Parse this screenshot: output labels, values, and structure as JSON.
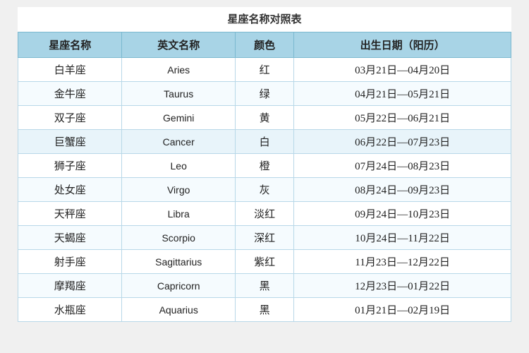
{
  "page": {
    "title": "星座名称对照表"
  },
  "table": {
    "headers": [
      "星座名称",
      "英文名称",
      "颜色",
      "出生日期（阳历）"
    ],
    "rows": [
      {
        "chinese": "白羊座",
        "english": "Aries",
        "color": "红",
        "dates": "03月21日—04月20日",
        "highlight": false
      },
      {
        "chinese": "金牛座",
        "english": "Taurus",
        "color": "绿",
        "dates": "04月21日—05月21日",
        "highlight": false
      },
      {
        "chinese": "双子座",
        "english": "Gemini",
        "color": "黄",
        "dates": "05月22日—06月21日",
        "highlight": false
      },
      {
        "chinese": "巨蟹座",
        "english": "Cancer",
        "color": "白",
        "dates": "06月22日—07月23日",
        "highlight": true
      },
      {
        "chinese": "狮子座",
        "english": "Leo",
        "color": "橙",
        "dates": "07月24日—08月23日",
        "highlight": false
      },
      {
        "chinese": "处女座",
        "english": "Virgo",
        "color": "灰",
        "dates": "08月24日—09月23日",
        "highlight": false
      },
      {
        "chinese": "天秤座",
        "english": "Libra",
        "color": "淡红",
        "dates": "09月24日—10月23日",
        "highlight": false
      },
      {
        "chinese": "天蝎座",
        "english": "Scorpio",
        "color": "深红",
        "dates": "10月24日—11月22日",
        "highlight": false
      },
      {
        "chinese": "射手座",
        "english": "Sagittarius",
        "color": "紫红",
        "dates": "11月23日—12月22日",
        "highlight": false
      },
      {
        "chinese": "摩羯座",
        "english": "Capricorn",
        "color": "黑",
        "dates": "12月23日—01月22日",
        "highlight": false
      },
      {
        "chinese": "水瓶座",
        "english": "Aquarius",
        "color": "黑",
        "dates": "01月21日—02月19日",
        "highlight": false
      }
    ]
  }
}
